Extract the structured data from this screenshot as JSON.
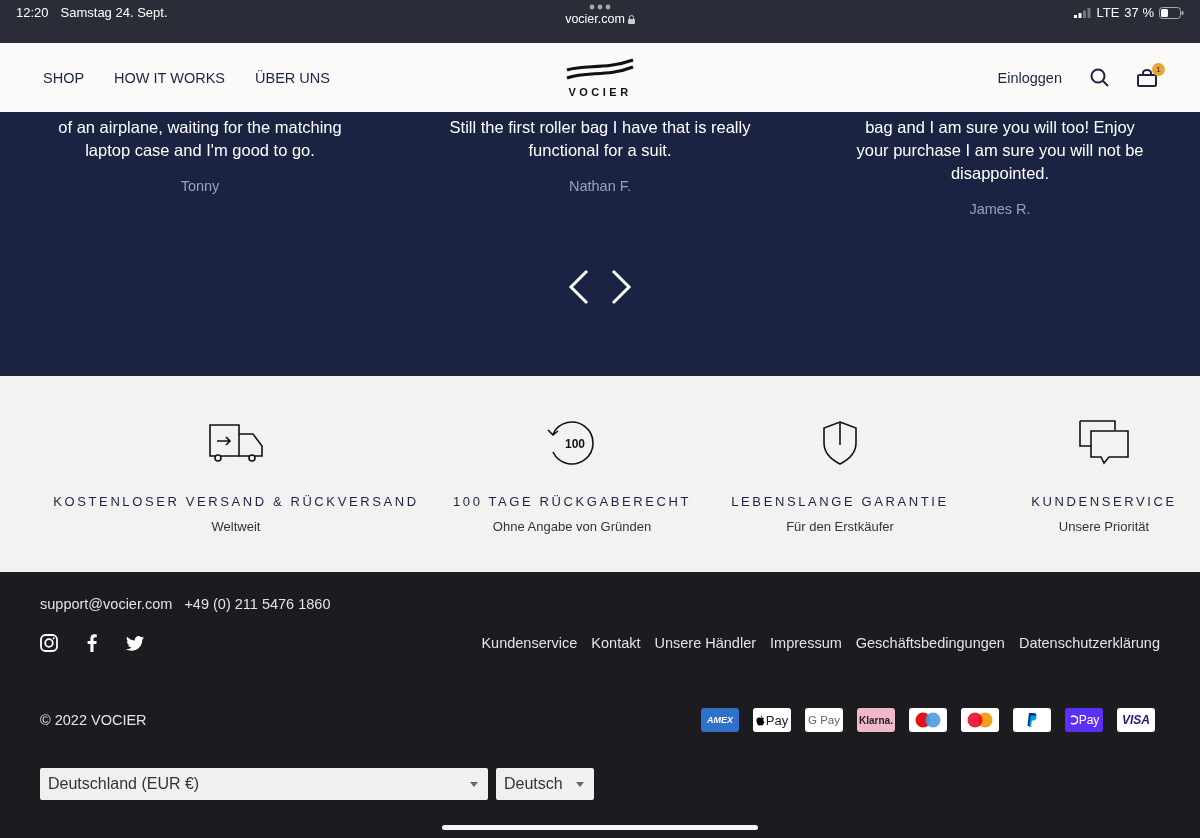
{
  "status_bar": {
    "time": "12:20",
    "date": "Samstag 24. Sept.",
    "url": "vocier.com",
    "network": "LTE",
    "battery": "37 %"
  },
  "header": {
    "nav": [
      "SHOP",
      "HOW IT WORKS",
      "ÜBER UNS"
    ],
    "logo": "VOCIER",
    "login": "Einloggen",
    "cart_count": "1"
  },
  "testimonials": [
    {
      "text": "of an airplane, waiting for the matching laptop case and I'm good to go.",
      "author": "Tonny"
    },
    {
      "text": "Still the first roller bag I have that is really functional for a suit.",
      "author": "Nathan F."
    },
    {
      "text": "bag and I am sure you will too! Enjoy your purchase I am sure you will not be disappointed.",
      "author": "James R."
    }
  ],
  "features": [
    {
      "kind": "truck",
      "title": "KOSTENLOSER VERSAND & RÜCKVERSAND",
      "subtitle": "Weltweit"
    },
    {
      "kind": "return",
      "badge": "100",
      "title": "100 TAGE RÜCKGABERECHT",
      "subtitle": "Ohne Angabe von Gründen"
    },
    {
      "kind": "shield",
      "title": "LEBENSLANGE GARANTIE",
      "subtitle": "Für den Erstkäufer"
    },
    {
      "kind": "chat",
      "title": "KUNDENSERVICE",
      "subtitle": "Unsere Priorität"
    }
  ],
  "footer": {
    "email": "support@vocier.com",
    "phone": "+49 (0) 211 5476 1860",
    "social": [
      {
        "kind": "instagram"
      },
      {
        "kind": "facebook"
      },
      {
        "kind": "twitter"
      }
    ],
    "links": [
      "Kundenservice",
      "Kontakt",
      "Unsere Händler",
      "Impressum",
      "Geschäftsbedingungen",
      "Datenschutzerklärung"
    ],
    "copyright": "© 2022 VOCIER",
    "payment_methods": [
      {
        "kind": "amex",
        "label": "AMEX"
      },
      {
        "kind": "applepay",
        "label": "Pay"
      },
      {
        "kind": "gpay",
        "label": "G Pay"
      },
      {
        "kind": "klarna",
        "label": "Klarna."
      },
      {
        "kind": "maestro"
      },
      {
        "kind": "mastercard"
      },
      {
        "kind": "paypal"
      },
      {
        "kind": "shoppay",
        "label": "Pay"
      },
      {
        "kind": "visa",
        "label": "VISA"
      }
    ],
    "country": "Deutschland (EUR €)",
    "language": "Deutsch"
  }
}
